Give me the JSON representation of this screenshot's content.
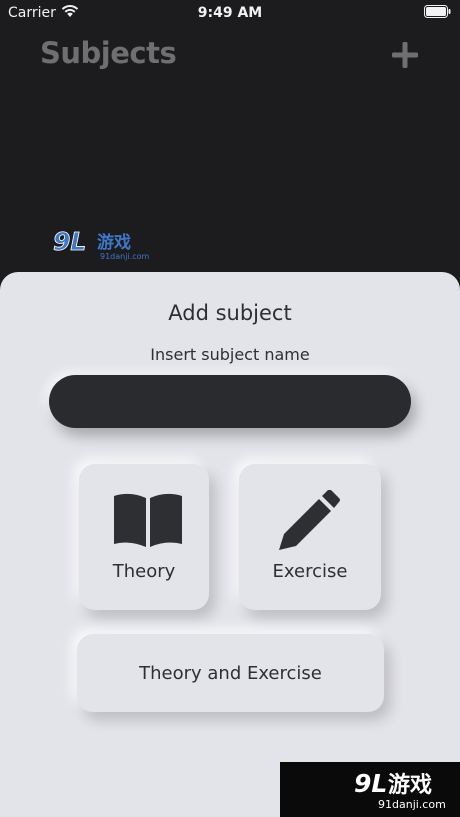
{
  "status_bar": {
    "carrier": "Carrier",
    "time": "9:49 AM"
  },
  "header": {
    "title": "Subjects",
    "add_icon": "plus-icon"
  },
  "watermark": {
    "logo_text": "9L游戏",
    "url": "91danji.com"
  },
  "sheet": {
    "title": "Add subject",
    "field_label": "Insert subject name",
    "input_value": "",
    "options": {
      "theory": {
        "label": "Theory",
        "icon": "book-icon"
      },
      "exercise": {
        "label": "Exercise",
        "icon": "pencil-icon"
      },
      "both": {
        "label": "Theory and Exercise"
      }
    }
  },
  "colors": {
    "background": "#1c1c1e",
    "sheet": "#e3e4ea",
    "input": "#2a2b2f",
    "text": "#2e2f33",
    "title_muted": "#6f6f72"
  }
}
